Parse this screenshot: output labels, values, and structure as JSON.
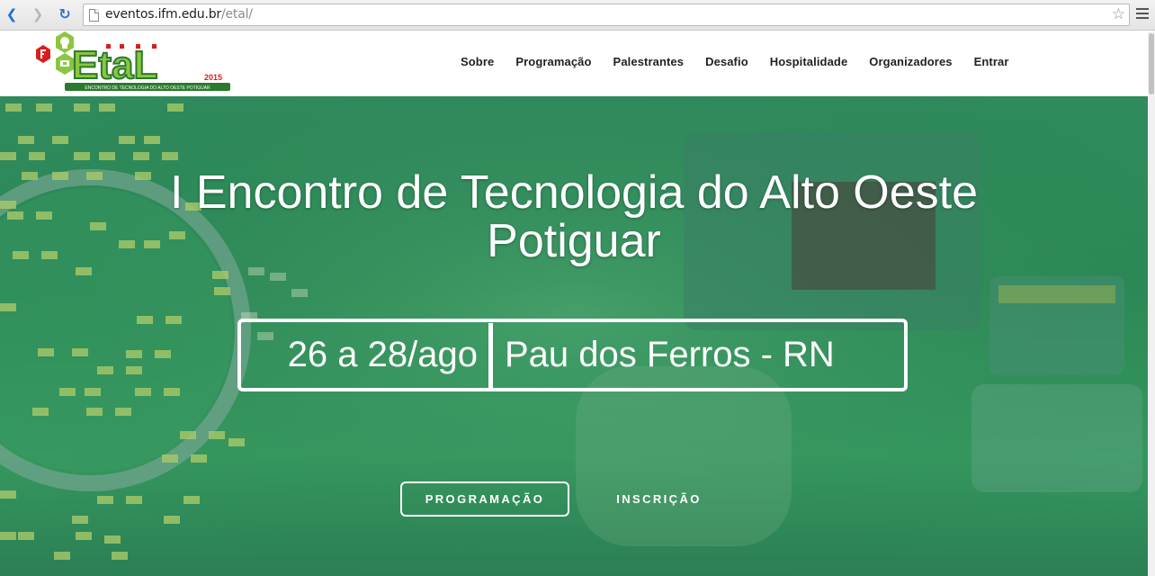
{
  "browser": {
    "url_host": "eventos.ifm.edu.br",
    "url_path": "/etal/",
    "icons": [
      "back-arrow-icon",
      "forward-arrow-icon",
      "reload-icon",
      "page-icon",
      "star-icon",
      "hamburger-menu-icon"
    ]
  },
  "header": {
    "logo": {
      "wordmark": "EtaL",
      "year": "2015",
      "tagline": "ENCONTRO DE TECNOLOGIA DO ALTO OESTE POTIGUAR"
    },
    "nav": [
      "Sobre",
      "Programação",
      "Palestrantes",
      "Desafio",
      "Hospitalidade",
      "Organizadores",
      "Entrar"
    ]
  },
  "hero": {
    "title_line1": "I Encontro de Tecnologia do Alto Oeste",
    "title_line2": "Potiguar",
    "date": "26 a 28/ago",
    "location": "Pau dos Ferros - RN",
    "button_primary": "PROGRAMAÇÃO",
    "button_secondary": "INSCRIÇÃO"
  },
  "colors": {
    "accent_green": "#8cc63f",
    "dark_green": "#2a7a2e",
    "logo_red": "#d81e1e",
    "hero_green": "#2f8a5c"
  }
}
